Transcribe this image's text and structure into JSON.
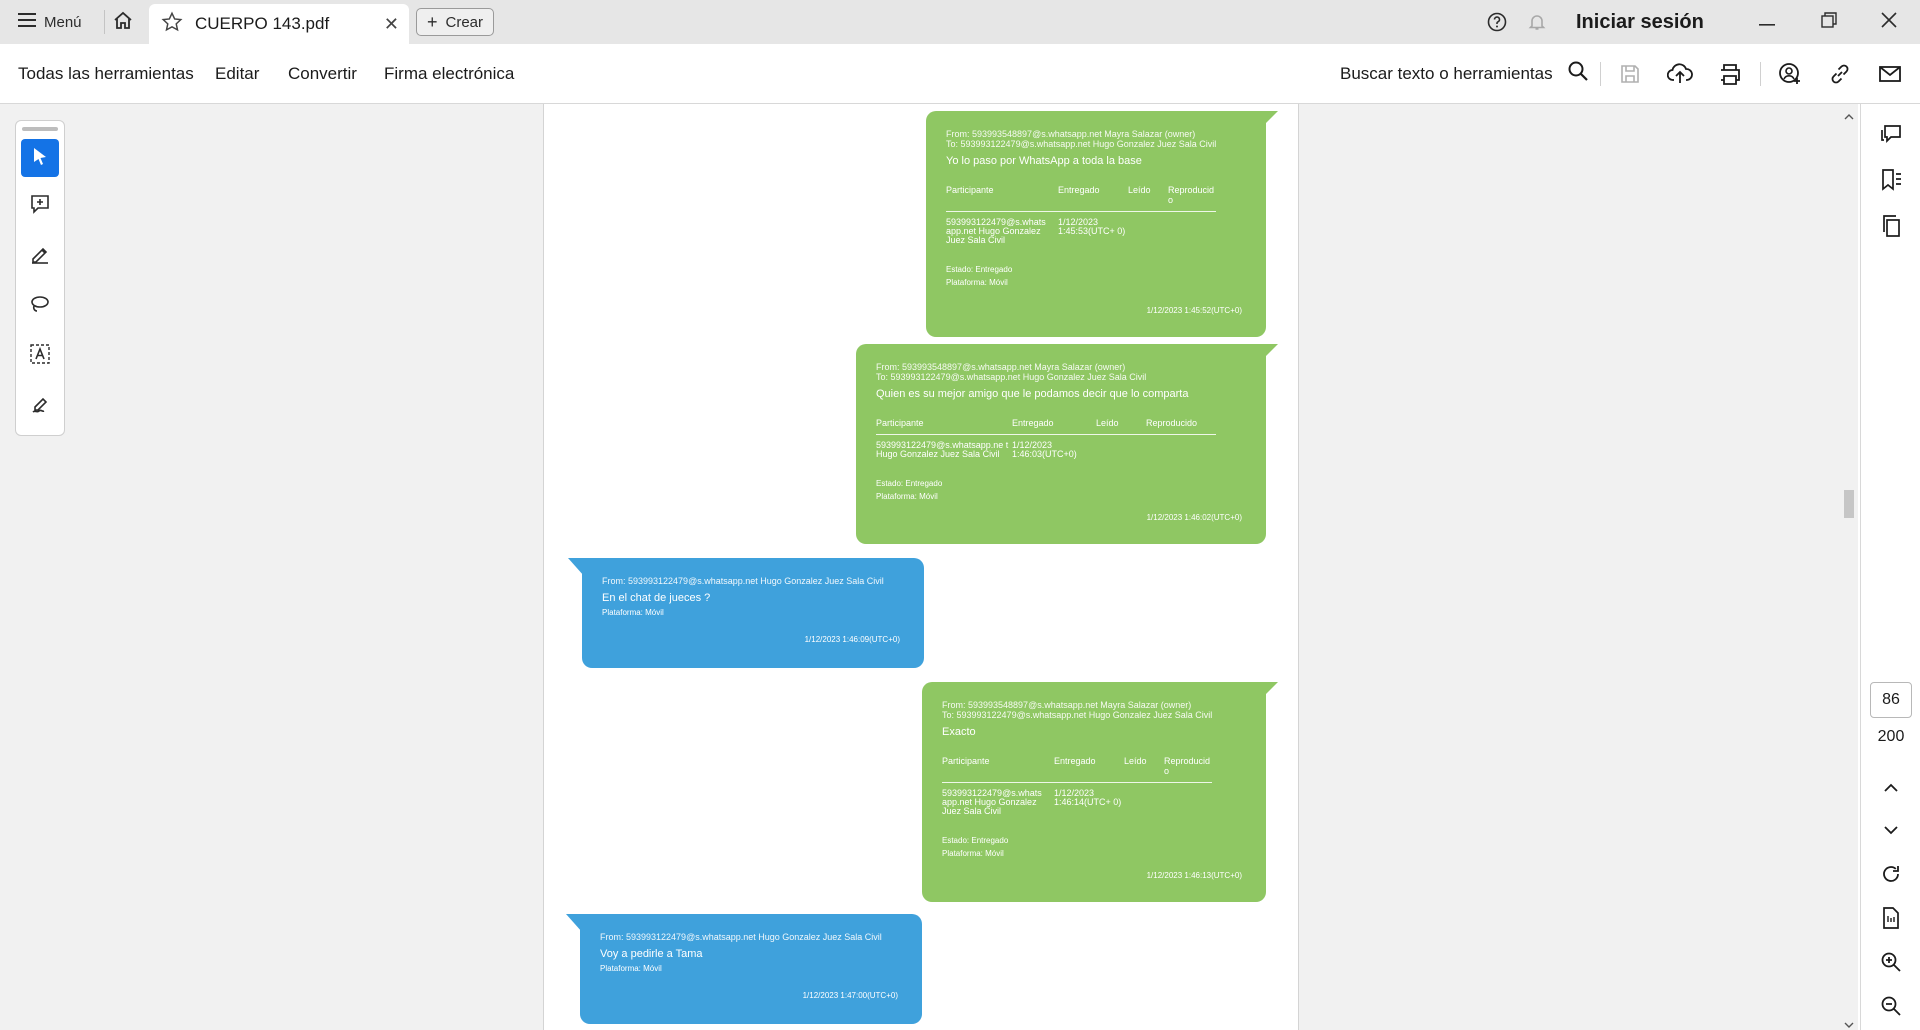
{
  "titlebar": {
    "menu_label": "Menú",
    "tab_title": "CUERPO 143.pdf",
    "create_label": "Crear",
    "signin_label": "Iniciar sesión"
  },
  "toolbar": {
    "tabs": [
      "Todas las herramientas",
      "Editar",
      "Convertir",
      "Firma electrónica"
    ],
    "search_label": "Buscar texto o herramientas"
  },
  "navigation": {
    "current_page": "86",
    "total_pages": "200"
  },
  "colors": {
    "accent": "#1473e6",
    "bubble_green": "#8fc763",
    "bubble_blue": "#3fa1dc"
  },
  "messages": [
    {
      "from": "From: 593993548897@s.whatsapp.net Mayra Salazar (owner)",
      "to": "To: 593993122479@s.whatsapp.net Hugo Gonzalez Juez Sala Civil",
      "text": "Yo lo paso por WhatsApp a toda la base",
      "table_head": [
        "Participante",
        "Entregado",
        "Leído",
        "Reproducid o"
      ],
      "table_row": [
        "593993122479@s.whats app.net Hugo Gonzalez Juez Sala Civil",
        "1/12/2023 1:45:53(UTC+ 0)",
        "",
        ""
      ],
      "estado": "Estado: Entregado",
      "plataforma": "Plataforma: Móvil",
      "time": "1/12/2023 1:45:52(UTC+0)"
    },
    {
      "from": "From: 593993548897@s.whatsapp.net Mayra Salazar (owner)",
      "to": "To: 593993122479@s.whatsapp.net Hugo Gonzalez Juez Sala Civil",
      "text": "Quien es su mejor amigo que le podamos decir que lo comparta",
      "table_head": [
        "Participante",
        "Entregado",
        "Leído",
        "Reproducido"
      ],
      "table_row": [
        "593993122479@s.whatsapp.ne t Hugo Gonzalez Juez Sala Civil",
        "1/12/2023 1:46:03(UTC+0)",
        "",
        ""
      ],
      "estado": "Estado: Entregado",
      "plataforma": "Plataforma: Móvil",
      "time": "1/12/2023 1:46:02(UTC+0)"
    },
    {
      "from": "From: 593993122479@s.whatsapp.net Hugo Gonzalez Juez Sala Civil",
      "text": "En el chat de jueces ?",
      "plataforma": "Plataforma: Móvil",
      "time": "1/12/2023 1:46:09(UTC+0)"
    },
    {
      "from": "From: 593993548897@s.whatsapp.net Mayra Salazar (owner)",
      "to": "To: 593993122479@s.whatsapp.net Hugo Gonzalez Juez Sala Civil",
      "text": "Exacto",
      "table_head": [
        "Participante",
        "Entregado",
        "Leído",
        "Reproducid o"
      ],
      "table_row": [
        "593993122479@s.whats app.net Hugo Gonzalez Juez Sala Civil",
        "1/12/2023 1:46:14(UTC+ 0)",
        "",
        ""
      ],
      "estado": "Estado: Entregado",
      "plataforma": "Plataforma: Móvil",
      "time": "1/12/2023 1:46:13(UTC+0)"
    },
    {
      "from": "From: 593993122479@s.whatsapp.net Hugo Gonzalez Juez Sala Civil",
      "text": "Voy a pedirle a Tama",
      "plataforma": "Plataforma: Móvil",
      "time": "1/12/2023 1:47:00(UTC+0)"
    }
  ]
}
